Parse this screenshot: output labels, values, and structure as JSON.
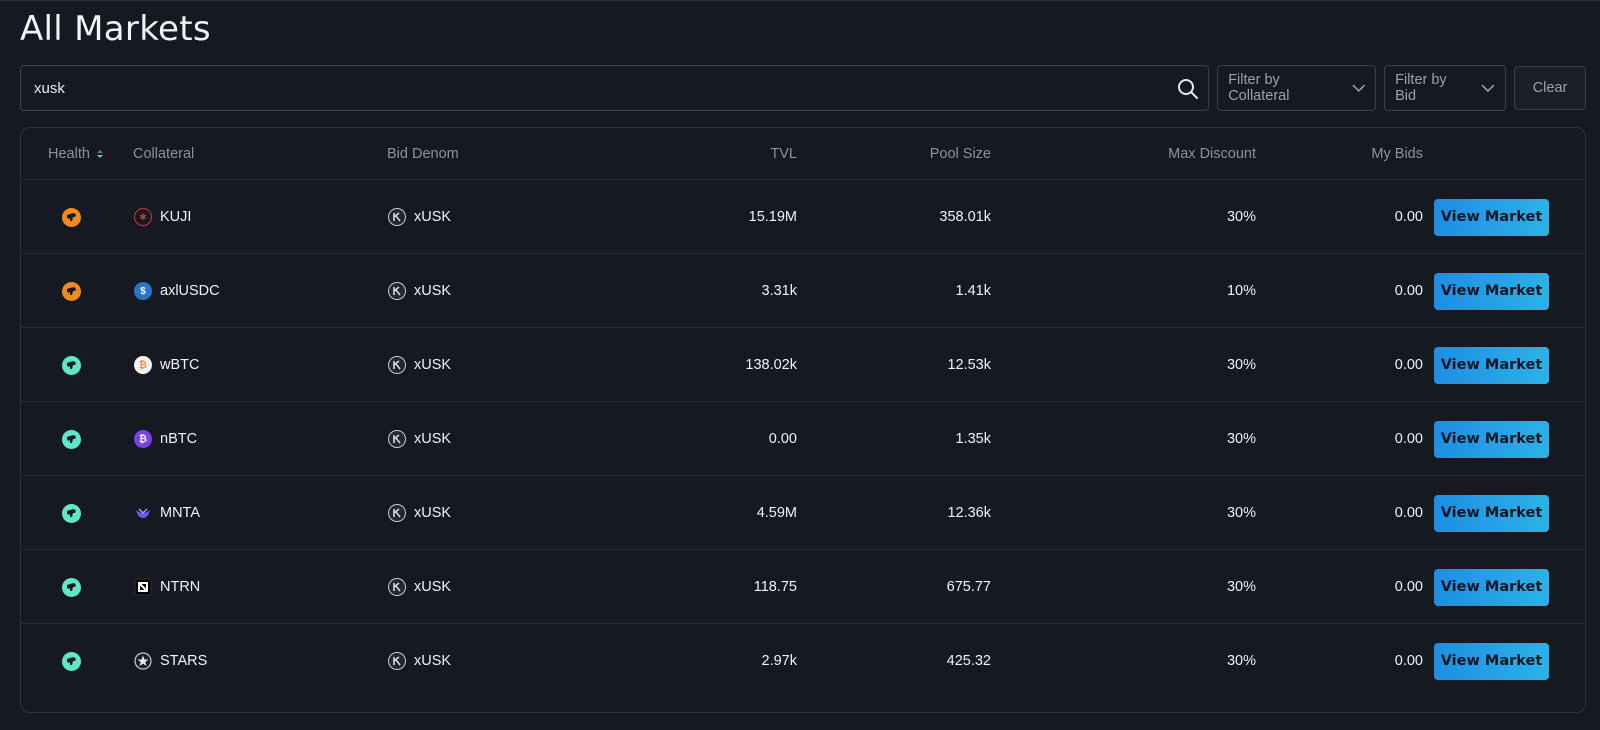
{
  "page": {
    "title": "All Markets"
  },
  "search": {
    "value": "xusk",
    "placeholder": ""
  },
  "filters": {
    "collateral_label": "Filter by Collateral",
    "bid_label": "Filter by Bid",
    "clear_label": "Clear"
  },
  "table": {
    "headers": {
      "health": "Health",
      "collateral": "Collateral",
      "bid_denom": "Bid Denom",
      "tvl": "TVL",
      "pool_size": "Pool Size",
      "max_discount": "Max Discount",
      "my_bids": "My Bids"
    },
    "button_label": "View Market",
    "rows": [
      {
        "health": "warning",
        "collateral": "KUJI",
        "bid_denom": "xUSK",
        "tvl": "15.19M",
        "pool_size": "358.01k",
        "max_discount": "30%",
        "my_bids": "0.00"
      },
      {
        "health": "warning",
        "collateral": "axlUSDC",
        "bid_denom": "xUSK",
        "tvl": "3.31k",
        "pool_size": "1.41k",
        "max_discount": "10%",
        "my_bids": "0.00"
      },
      {
        "health": "healthy",
        "collateral": "wBTC",
        "bid_denom": "xUSK",
        "tvl": "138.02k",
        "pool_size": "12.53k",
        "max_discount": "30%",
        "my_bids": "0.00"
      },
      {
        "health": "healthy",
        "collateral": "nBTC",
        "bid_denom": "xUSK",
        "tvl": "0.00",
        "pool_size": "1.35k",
        "max_discount": "30%",
        "my_bids": "0.00"
      },
      {
        "health": "healthy",
        "collateral": "MNTA",
        "bid_denom": "xUSK",
        "tvl": "4.59M",
        "pool_size": "12.36k",
        "max_discount": "30%",
        "my_bids": "0.00"
      },
      {
        "health": "healthy",
        "collateral": "NTRN",
        "bid_denom": "xUSK",
        "tvl": "118.75",
        "pool_size": "675.77",
        "max_discount": "30%",
        "my_bids": "0.00"
      },
      {
        "health": "healthy",
        "collateral": "STARS",
        "bid_denom": "xUSK",
        "tvl": "2.97k",
        "pool_size": "425.32",
        "max_discount": "30%",
        "my_bids": "0.00"
      }
    ]
  },
  "colors": {
    "health_warning": "#f08a1c",
    "health_healthy": "#5ee8c8",
    "accent": "#2296e2",
    "background": "#161822"
  },
  "icons": {
    "health": "bull-icon",
    "search": "search-icon",
    "chevron": "chevron-down-icon",
    "sort": "sort-icon"
  }
}
